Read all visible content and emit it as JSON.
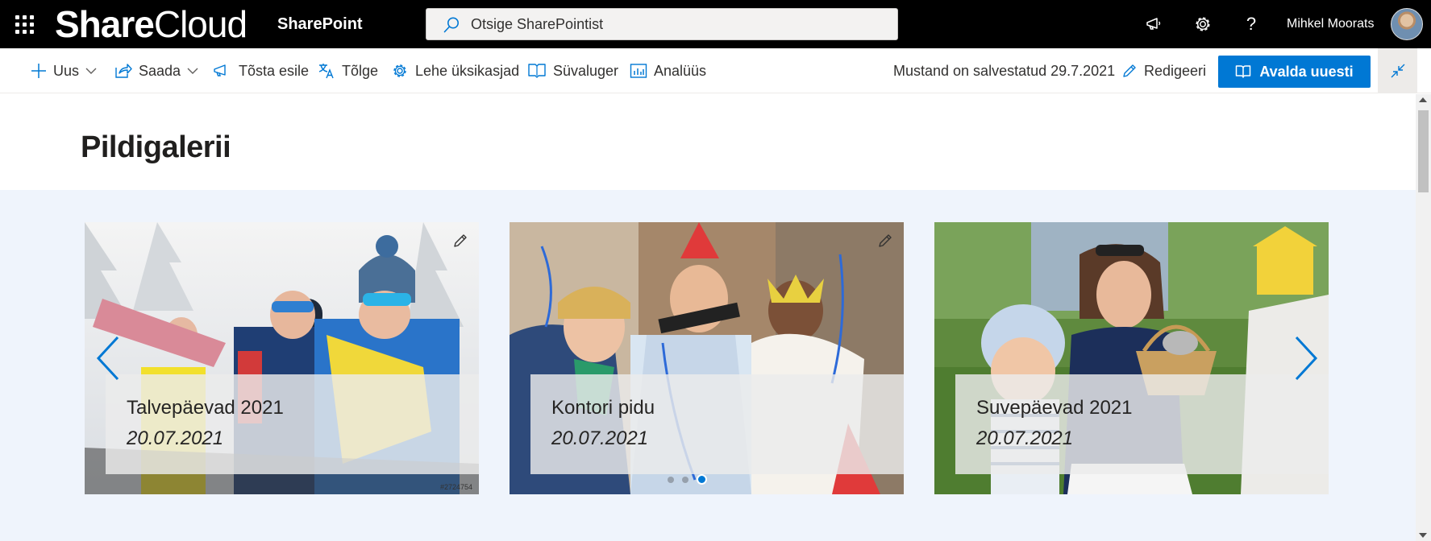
{
  "suite": {
    "brand_bold": "Share",
    "brand_light": "Cloud",
    "app_name": "SharePoint",
    "search_placeholder": "Otsige SharePointist",
    "user_name": "Mihkel Moorats"
  },
  "commands": {
    "new": "Uus",
    "send": "Saada",
    "promote": "Tõsta esile",
    "translate": "Tõlge",
    "page_details": "Lehe üksikasjad",
    "immersive_reader": "Süvaluger",
    "analytics": "Analüüs",
    "saved_status": "Mustand on salvestatud 29.7.2021",
    "edit": "Redigeeri",
    "republish": "Avalda uuesti"
  },
  "page": {
    "title": "Pildigalerii"
  },
  "gallery": {
    "cards": [
      {
        "title": "Talvepäevad 2021",
        "date": "20.07.2021",
        "watermark": "#2724754"
      },
      {
        "title": "Kontori pidu",
        "date": "20.07.2021"
      },
      {
        "title": "Suvepäevad 2021",
        "date": "20.07.2021"
      }
    ],
    "active_page": 2,
    "page_count": 3
  },
  "colors": {
    "suite_bar": "#000000",
    "accent": "#0078d4",
    "section_bg": "#eff4fc"
  }
}
